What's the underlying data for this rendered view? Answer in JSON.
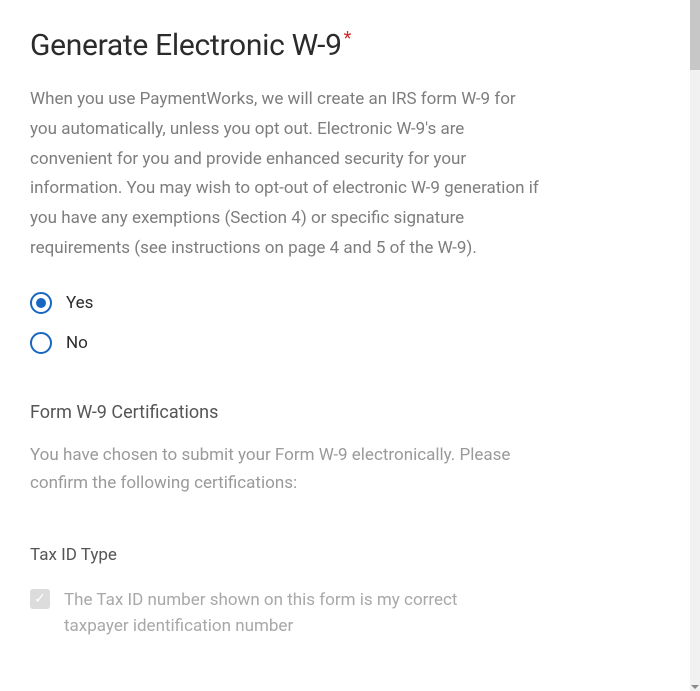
{
  "title": "Generate Electronic W-9",
  "required_marker": "*",
  "description": "When you use PaymentWorks, we will create an IRS form W-9 for you automatically, unless you opt out. Electronic W-9's are convenient for you and provide enhanced security for your information. You may wish to opt-out of electronic W-9 generation if you have any exemptions (Section 4) or specific signature requirements (see instructions on page 4 and 5 of the W-9).",
  "radio_options": {
    "yes": "Yes",
    "no": "No"
  },
  "certifications": {
    "heading": "Form W-9 Certifications",
    "description": "You have chosen to submit your Form W-9 electronically. Please confirm the following certifications:"
  },
  "tax_id": {
    "heading": "Tax ID Type",
    "checkbox_label": "The Tax ID number shown on this form is my correct taxpayer identification number"
  }
}
